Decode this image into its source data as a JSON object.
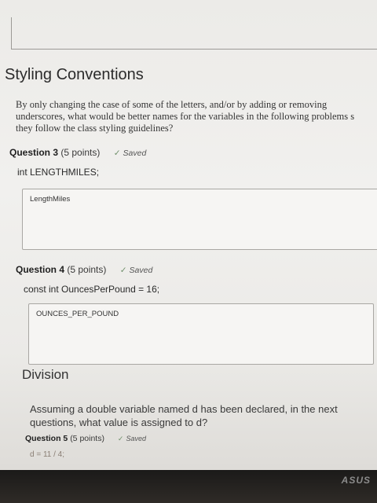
{
  "section": {
    "title": "Styling Conventions",
    "intro_lines": [
      "By only changing the case of some of the letters, and/or by adding or removing",
      "underscores, what would be better names for the variables in the following problems s",
      "they follow the class styling guidelines?"
    ]
  },
  "questions": [
    {
      "label": "Question 3",
      "points": "(5 points)",
      "status": "Saved",
      "text": "int LENGTHMILES;",
      "answer": "LengthMiles"
    },
    {
      "label": "Question 4",
      "points": "(5 points)",
      "status": "Saved",
      "text": "const int OuncesPerPound = 16;",
      "answer": "OUNCES_PER_POUND"
    }
  ],
  "division": {
    "title": "Division",
    "text_lines": [
      "Assuming a double variable named d has been declared, in the next",
      "questions, what value is assigned to d?"
    ],
    "question": {
      "label": "Question 5",
      "points": "(5 points)",
      "status": "Saved",
      "partial_text": "d = 11 / 4;"
    }
  },
  "monitor": {
    "brand": "ASUS"
  },
  "colors": {
    "background": "#efeeec",
    "check": "#6f8f6a",
    "border": "#a9a7a3"
  },
  "icons": {
    "saved": "check-icon"
  }
}
